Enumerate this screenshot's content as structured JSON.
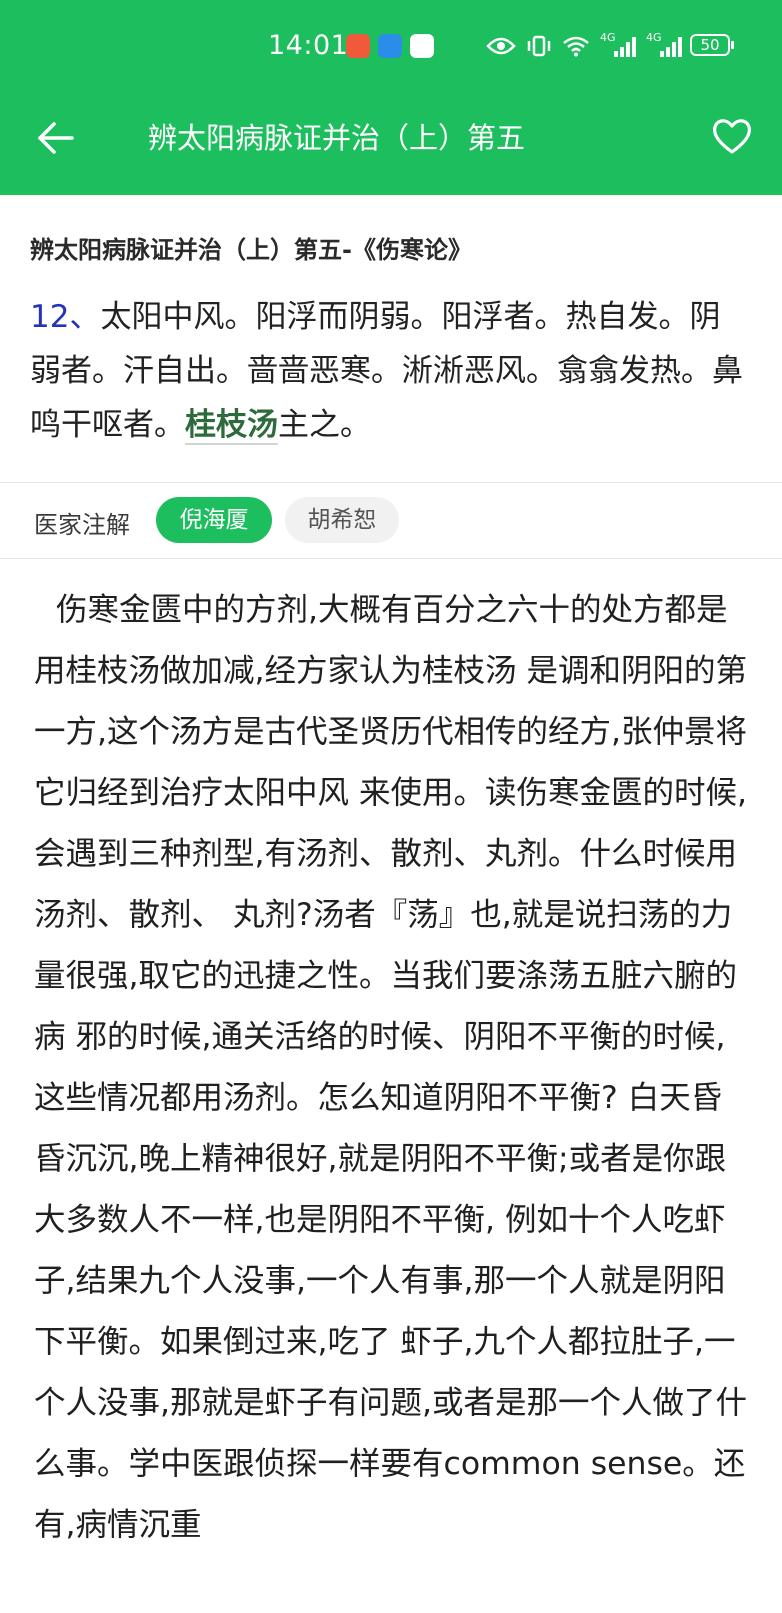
{
  "status_bar": {
    "time": "14:01",
    "network_1": "4G",
    "network_2": "4G",
    "battery": "50"
  },
  "header": {
    "title": "辨太阳病脉证并治（上）第五"
  },
  "subtitle": "辨太阳病脉证并治（上）第五-《伤寒论》",
  "verse": {
    "number": "12、",
    "text_before": "太阳中风。阳浮而阴弱。阳浮者。热自发。阴弱者。汗自出。啬啬恶寒。淅淅恶风。翕翕发热。鼻鸣干呕者。",
    "link": "桂枝汤",
    "text_after": "主之。"
  },
  "commentary": {
    "label": "医家注解",
    "tabs": [
      {
        "label": "倪海厦",
        "active": true
      },
      {
        "label": "胡希恕",
        "active": false
      }
    ]
  },
  "body": "伤寒金匮中的方剂,大概有百分之六十的处方都是用桂枝汤做加减,经方家认为桂枝汤 是调和阴阳的第一方,这个汤方是古代圣贤历代相传的经方,张仲景将它归经到治疗太阳中风 来使用。读伤寒金匮的时候,会遇到三种剂型,有汤剂、散剂、丸剂。什么时候用汤剂、散剂、 丸剂?汤者『荡』也,就是说扫荡的力量很强,取它的迅捷之性。当我们要涤荡五脏六腑的病 邪的时候,通关活络的时候、阴阳不平衡的时候,这些情况都用汤剂。怎么知道阴阳不平衡? 白天昏昏沉沉,晚上精神很好,就是阴阳不平衡;或者是你跟大多数人不一样,也是阴阳不平衡, 例如十个人吃虾子,结果九个人没事,一个人有事,那一个人就是阴阳下平衡。如果倒过来,吃了 虾子,九个人都拉肚子,一个人没事,那就是虾子有问题,或者是那一个人做了什么事。学中医跟侦探一样要有common sense。还有,病情沉重"
}
